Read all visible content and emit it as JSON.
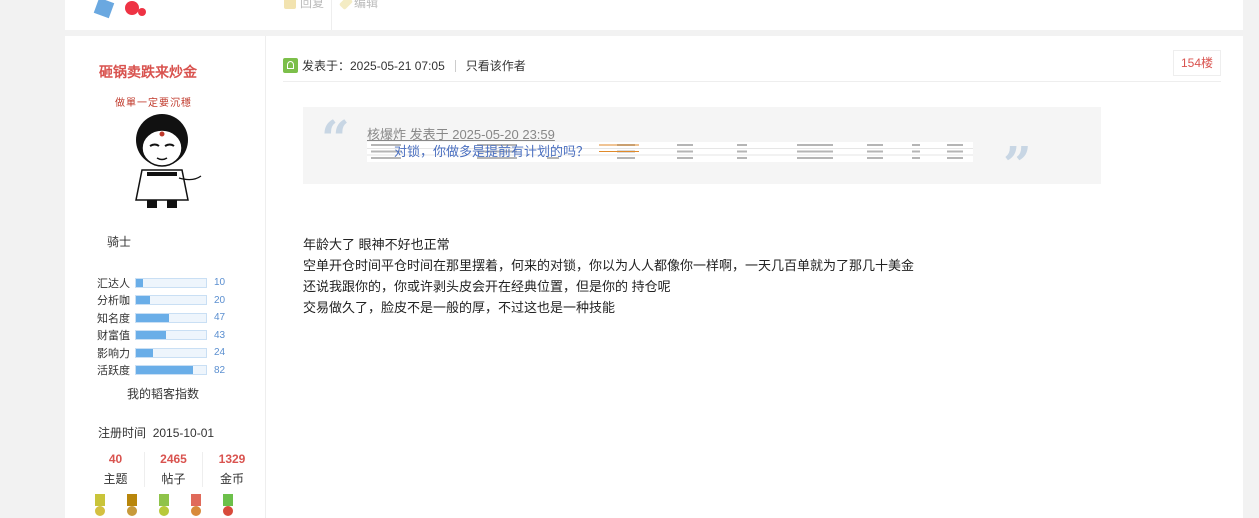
{
  "previous_post": {
    "actions": [
      {
        "icon": "reply-icon",
        "label": "回复"
      },
      {
        "icon": "edit-icon",
        "label": "编辑"
      }
    ]
  },
  "author": {
    "username": "砸锅卖跌来炒金",
    "signature": "做單一定要沉穩",
    "rank": "骑士",
    "stats": [
      {
        "label": "汇达人",
        "value": "10",
        "percent": 10
      },
      {
        "label": "分析咖",
        "value": "20",
        "percent": 20
      },
      {
        "label": "知名度",
        "value": "47",
        "percent": 47
      },
      {
        "label": "财富值",
        "value": "43",
        "percent": 43
      },
      {
        "label": "影响力",
        "value": "24",
        "percent": 24
      },
      {
        "label": "活跃度",
        "value": "82",
        "percent": 82
      }
    ],
    "index_link": "我的韬客指数",
    "register_label": "注册时间",
    "register_date": "2015-10-01",
    "counts": [
      {
        "num": "40",
        "label": "主题"
      },
      {
        "num": "2465",
        "label": "帖子"
      },
      {
        "num": "1329",
        "label": "金币"
      }
    ],
    "medals": [
      {
        "ribbon": "#c9c43a",
        "disc": "#d4c040"
      },
      {
        "ribbon": "#b8860b",
        "disc": "#c79a3a"
      },
      {
        "ribbon": "#8fc34a",
        "disc": "#b8c93a"
      },
      {
        "ribbon": "#e06a5a",
        "disc": "#d88a3a"
      },
      {
        "ribbon": "#6cc04a",
        "disc": "#d84a3a"
      }
    ]
  },
  "post": {
    "posted_at": "发表于：2025-05-21 07:05",
    "author_only": "只看该作者",
    "floor": "154楼",
    "quote": {
      "author_line": "核爆炸 发表于 2025-05-20 23:59",
      "text": "对锁，你做多是提前有计划的吗？"
    },
    "body_lines": [
      "年龄大了  眼神不好也正常",
      "空单开仓时间平仓时间在那里摆着，何来的对锁，你以为人人都像你一样啊，一天几百单就为了那几十美金",
      "还说我跟你的，你或许剥头皮会开在经典位置，但是你的 持仓呢",
      "交易做久了，脸皮不是一般的厚，不过这也是一种技能"
    ]
  },
  "colors": {
    "username": "#d9534f",
    "floor": "#d9534f",
    "stat_fill": "#6aaee8",
    "quote_link": "#4a6fc0"
  }
}
